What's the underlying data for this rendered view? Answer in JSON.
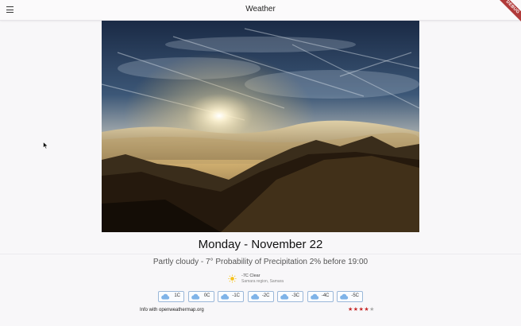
{
  "appbar": {
    "title": "Weather",
    "debug_label": "DEBUG"
  },
  "date": "Monday - November 22",
  "description": "Partly cloudy - 7° Probability of Precipitation 2% before 19:00",
  "current": {
    "line1": "-7C Clear",
    "line2": "Samara region, Samara",
    "icon": "sun-icon"
  },
  "forecast": [
    {
      "temp": "1C",
      "icon": "cloud-icon"
    },
    {
      "temp": "0C",
      "icon": "cloud-icon"
    },
    {
      "temp": "-1C",
      "icon": "cloud-icon"
    },
    {
      "temp": "-2C",
      "icon": "cloud-icon"
    },
    {
      "temp": "-3C",
      "icon": "cloud-icon"
    },
    {
      "temp": "-4C",
      "icon": "cloud-icon"
    },
    {
      "temp": "-5C",
      "icon": "cloud-icon"
    }
  ],
  "info": "Info with openweathermap.org",
  "rating": {
    "value": 4,
    "max": 5
  },
  "colors": {
    "star_filled": "#c62828",
    "star_empty": "#aaaaaa",
    "chip_border": "#9bb8d9",
    "cloud": "#7fb3e8"
  }
}
